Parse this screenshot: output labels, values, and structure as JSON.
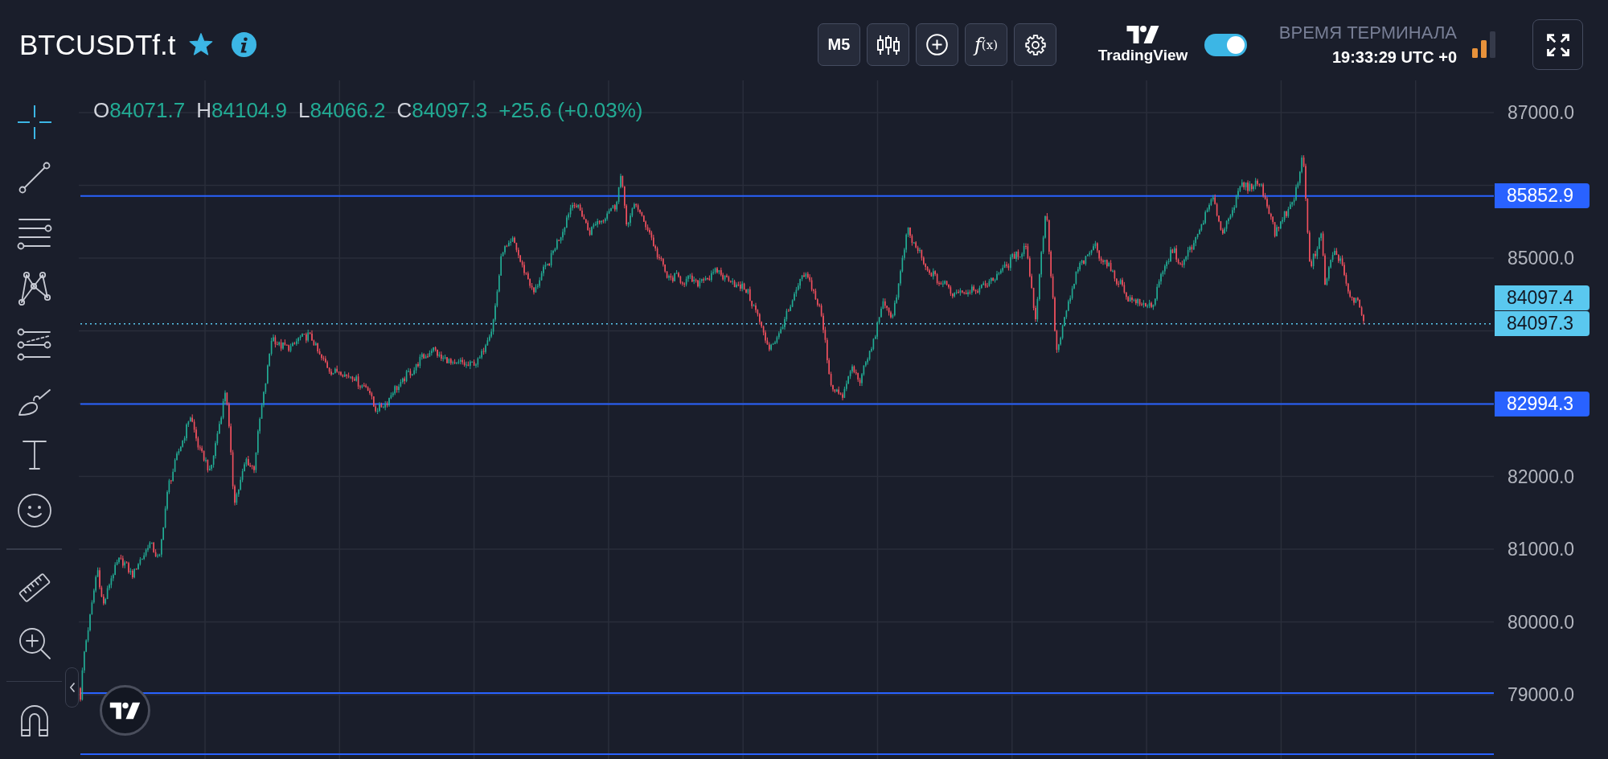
{
  "header": {
    "symbol": "BTCUSDTf.t",
    "favorite": true,
    "timeframe": "M5",
    "indicators": "*f*(x)",
    "brand": "TradingView",
    "toggle": {
      "on": true
    },
    "terminal_time": {
      "label": "ВРЕМЯ ТЕРМИНАЛА",
      "value": "19:33:29 UTC +0"
    }
  },
  "legend": {
    "items": [
      {
        "key": "O",
        "value": "84071.7"
      },
      {
        "key": "H",
        "value": "84104.9"
      },
      {
        "key": "L",
        "value": "84066.2"
      },
      {
        "key": "C",
        "value": "84097.3"
      }
    ],
    "change": "+25.6 (+0.03%)"
  },
  "price_axis": {
    "ticks": [
      "87000.0",
      "85000.0",
      "82000.0",
      "81000.0",
      "80000.0",
      "79000.0"
    ],
    "labels": [
      {
        "kind": "level",
        "text": "85852.9"
      },
      {
        "kind": "quote",
        "text": "84097.4"
      },
      {
        "kind": "last",
        "text": "84097.3"
      },
      {
        "kind": "level",
        "text": "82994.3"
      }
    ]
  }
}
